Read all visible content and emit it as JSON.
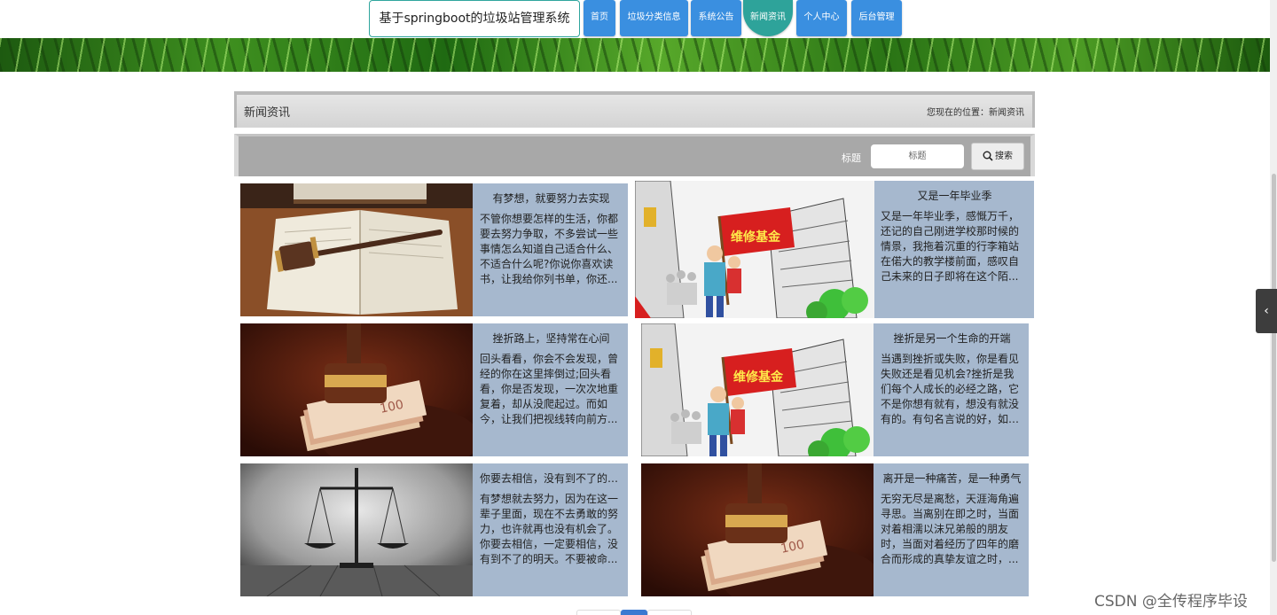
{
  "header": {
    "site_title": "基于springboot的垃圾站管理系统",
    "nav": [
      {
        "label": "首页",
        "active": false
      },
      {
        "label": "垃圾分类信息",
        "active": false
      },
      {
        "label": "系统公告",
        "active": false
      },
      {
        "label": "新闻资讯",
        "active": true
      },
      {
        "label": "个人中心",
        "active": false
      },
      {
        "label": "后台管理",
        "active": false
      }
    ]
  },
  "breadcrumb": {
    "title": "新闻资讯",
    "location": "您现在的位置：新闻资讯"
  },
  "search": {
    "label": "标题",
    "placeholder": "标题",
    "button_label": "搜索"
  },
  "news": [
    {
      "title": "有梦想，就要努力去实现",
      "summary": "不管你想要怎样的生活，你都要去努力争取，不多尝试一些事情怎么知道自己适合什么、不适合什么呢?你说你喜欢读书，让我给你列书单，你还...",
      "image": "gavel-on-book"
    },
    {
      "title": "又是一年毕业季",
      "summary": "又是一年毕业季，感慨万千，还记的自己刚进学校那时候的情景，我拖着沉重的行李箱站在偌大的教学楼前面，感叹自己未来的日子即将在这个陌...",
      "image": "rights-protest-cartoon"
    },
    {
      "title": "挫折路上，坚持常在心间",
      "summary": "回头看看，你会不会发现，曾经的你在这里摔倒过;回头看看，你是否发现，一次次地重复着，却从没爬起过。而如今，让我们把视线转向前方...",
      "image": "gavel-on-money"
    },
    {
      "title": "挫折是另一个生命的开端",
      "summary": "当遇到挫折或失败，你是看见失败还是看见机会?挫折是我们每个人成长的必经之路，它不是你想有就有，想没有就没有的。有句名言说的好，如果...",
      "image": "rights-protest-cartoon"
    },
    {
      "title": "你要去相信，没有到不了的明天",
      "summary": "有梦想就去努力，因为在这一辈子里面，现在不去勇敢的努力，也许就再也没有机会了。你要去相信，一定要相信，没有到不了的明天。不要被命...",
      "image": "scales-of-justice"
    },
    {
      "title": "离开是一种痛苦，是一种勇气",
      "summary": "无穷无尽是离愁，天涯海角遍寻思。当离别在即之时，当面对着相濡以沫兄弟般的朋友时，当面对着经历了四年的磨合而形成的真挚友谊之时，...",
      "image": "gavel-on-money"
    }
  ],
  "watermark": "CSDN @全传程序毕设",
  "colors": {
    "nav_button": "#3a8fe0",
    "nav_active": "#2ea39a",
    "card_bg": "#a6b8ce"
  }
}
